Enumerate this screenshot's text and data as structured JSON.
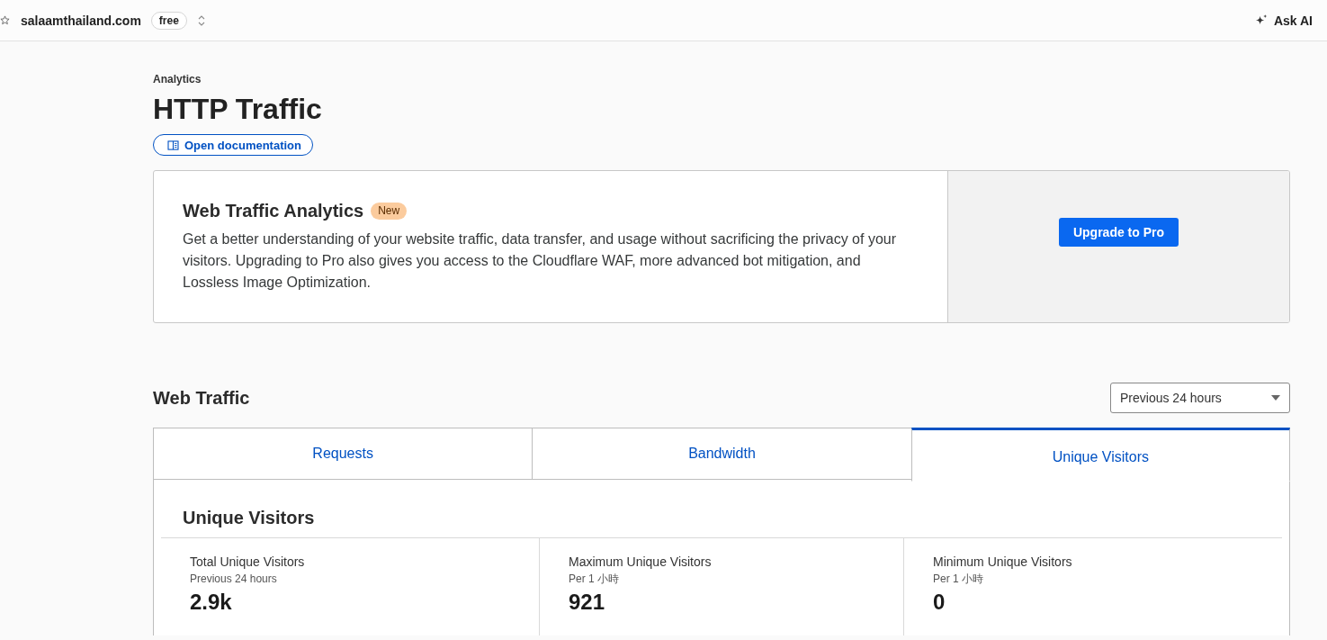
{
  "header": {
    "domain": "salaamthailand.com",
    "plan_badge": "free",
    "ask_ai": "Ask AI"
  },
  "page": {
    "breadcrumb": "Analytics",
    "title": "HTTP Traffic",
    "doc_link": "Open documentation"
  },
  "promo": {
    "title": "Web Traffic Analytics",
    "badge": "New",
    "text": "Get a better understanding of your website traffic, data transfer, and usage without sacrificing the privacy of your visitors. Upgrading to Pro also gives you access to the Cloudflare WAF, more advanced bot mitigation, and Lossless Image Optimization.",
    "button": "Upgrade to Pro"
  },
  "web_traffic": {
    "title": "Web Traffic",
    "range_select": {
      "value": "Previous 24 hours"
    },
    "tabs": [
      {
        "label": "Requests",
        "selected": false
      },
      {
        "label": "Bandwidth",
        "selected": false
      },
      {
        "label": "Unique Visitors",
        "selected": true
      }
    ],
    "panel": {
      "title": "Unique Visitors",
      "stats": [
        {
          "label": "Total Unique Visitors",
          "sublabel": "Previous 24 hours",
          "value": "2.9k"
        },
        {
          "label": "Maximum Unique Visitors",
          "sublabel": "Per 1 小時",
          "value": "921"
        },
        {
          "label": "Minimum Unique Visitors",
          "sublabel": "Per 1 小時",
          "value": "0"
        }
      ]
    }
  }
}
